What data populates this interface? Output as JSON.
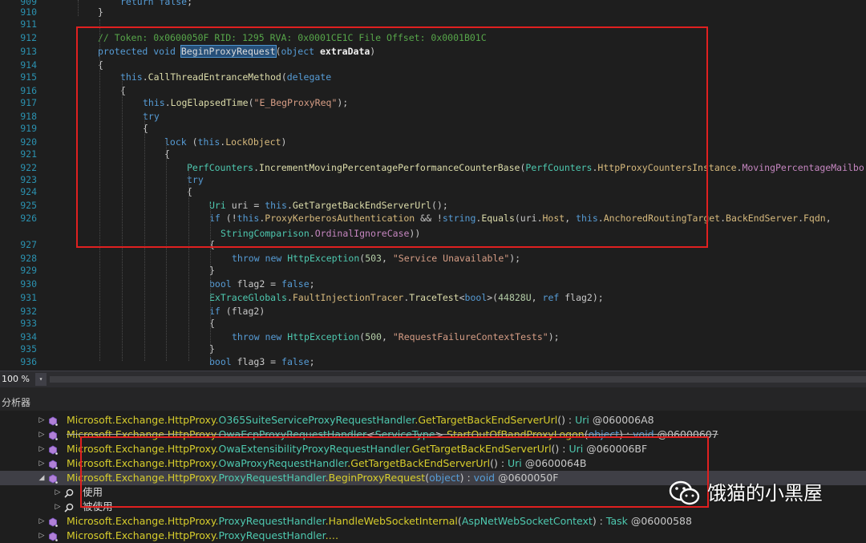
{
  "editor": {
    "lines": [
      {
        "no": "909",
        "segs": [
          [
            "kw",
            "return "
          ],
          [
            "kw",
            "false"
          ],
          [
            "p",
            ";"
          ]
        ]
      },
      {
        "no": "910",
        "segs": [
          [
            "p",
            "}"
          ]
        ]
      },
      {
        "no": "911",
        "segs": []
      },
      {
        "no": "912",
        "segs": [
          [
            "cm",
            "// Token: 0x0600050F RID: 1295 RVA: 0x0001CE1C File Offset: 0x0001B01C"
          ]
        ]
      },
      {
        "no": "913",
        "segs": [
          [
            "kw",
            "protected "
          ],
          [
            "kw",
            "void "
          ],
          [
            "hl",
            "BeginProxyRequest"
          ],
          [
            "p",
            "("
          ],
          [
            "kw",
            "object "
          ],
          [
            "b",
            "extraData"
          ],
          [
            "p",
            ")"
          ]
        ]
      },
      {
        "no": "914",
        "segs": [
          [
            "p",
            "{"
          ]
        ]
      },
      {
        "no": "915",
        "segs": [
          [
            "kw",
            "this"
          ],
          [
            "p",
            "."
          ],
          [
            "m",
            "CallThreadEntranceMethod"
          ],
          [
            "p",
            "("
          ],
          [
            "kw",
            "delegate"
          ]
        ]
      },
      {
        "no": "916",
        "segs": [
          [
            "p",
            "{"
          ]
        ]
      },
      {
        "no": "917",
        "segs": [
          [
            "kw",
            "this"
          ],
          [
            "p",
            "."
          ],
          [
            "m",
            "LogElapsedTime"
          ],
          [
            "p",
            "("
          ],
          [
            "s",
            "\"E_BegProxyReq\""
          ],
          [
            "p",
            ");"
          ]
        ]
      },
      {
        "no": "918",
        "segs": [
          [
            "kw",
            "try"
          ]
        ]
      },
      {
        "no": "919",
        "segs": [
          [
            "p",
            "{"
          ]
        ]
      },
      {
        "no": "920",
        "segs": [
          [
            "kw",
            "lock "
          ],
          [
            "p",
            "("
          ],
          [
            "kw",
            "this"
          ],
          [
            "p",
            "."
          ],
          [
            "pr",
            "LockObject"
          ],
          [
            "p",
            ")"
          ]
        ]
      },
      {
        "no": "921",
        "segs": [
          [
            "p",
            "{"
          ]
        ]
      },
      {
        "no": "922",
        "segs": [
          [
            "ty",
            "PerfCounters"
          ],
          [
            "p",
            "."
          ],
          [
            "m",
            "IncrementMovingPercentagePerformanceCounterBase"
          ],
          [
            "p",
            "("
          ],
          [
            "ty",
            "PerfCounters"
          ],
          [
            "p",
            "."
          ],
          [
            "pr",
            "HttpProxyCountersInstance"
          ],
          [
            "p",
            "."
          ],
          [
            "pu",
            "MovingPercentageMailbo"
          ]
        ]
      },
      {
        "no": "923",
        "segs": [
          [
            "kw",
            "try"
          ]
        ]
      },
      {
        "no": "924",
        "segs": [
          [
            "p",
            "{"
          ]
        ]
      },
      {
        "no": "925",
        "segs": [
          [
            "ty",
            "Uri "
          ],
          [
            "p",
            "uri = "
          ],
          [
            "kw",
            "this"
          ],
          [
            "p",
            "."
          ],
          [
            "m",
            "GetTargetBackEndServerUrl"
          ],
          [
            "p",
            "();"
          ]
        ]
      },
      {
        "no": "926",
        "segs": [
          [
            "kw",
            "if "
          ],
          [
            "p",
            "(!"
          ],
          [
            "kw",
            "this"
          ],
          [
            "p",
            "."
          ],
          [
            "pr",
            "ProxyKerberosAuthentication"
          ],
          [
            "p",
            " && !"
          ],
          [
            "kw",
            "string"
          ],
          [
            "p",
            "."
          ],
          [
            "m",
            "Equals"
          ],
          [
            "p",
            "(uri."
          ],
          [
            "pr",
            "Host"
          ],
          [
            "p",
            ", "
          ],
          [
            "kw",
            "this"
          ],
          [
            "p",
            "."
          ],
          [
            "pr",
            "AnchoredRoutingTarget"
          ],
          [
            "p",
            "."
          ],
          [
            "pr",
            "BackEndServer"
          ],
          [
            "p",
            "."
          ],
          [
            "pr",
            "Fqdn"
          ],
          [
            "p",
            ","
          ]
        ]
      },
      {
        "no": "",
        "segs": [
          [
            "ty",
            "StringComparison"
          ],
          [
            "p",
            "."
          ],
          [
            "pu",
            "OrdinalIgnoreCase"
          ],
          [
            "p",
            "))"
          ]
        ]
      },
      {
        "no": "927",
        "segs": [
          [
            "p",
            "{"
          ]
        ]
      },
      {
        "no": "928",
        "segs": [
          [
            "kw",
            "throw "
          ],
          [
            "kw",
            "new "
          ],
          [
            "ty",
            "HttpException"
          ],
          [
            "p",
            "("
          ],
          [
            "n",
            "503"
          ],
          [
            "p",
            ", "
          ],
          [
            "s",
            "\"Service Unavailable\""
          ],
          [
            "p",
            ");"
          ]
        ]
      },
      {
        "no": "929",
        "segs": [
          [
            "p",
            "}"
          ]
        ]
      },
      {
        "no": "930",
        "segs": [
          [
            "kw",
            "bool "
          ],
          [
            "p",
            "flag2 = "
          ],
          [
            "kw",
            "false"
          ],
          [
            "p",
            ";"
          ]
        ]
      },
      {
        "no": "931",
        "segs": [
          [
            "ty",
            "ExTraceGlobals"
          ],
          [
            "p",
            "."
          ],
          [
            "pr",
            "FaultInjectionTracer"
          ],
          [
            "p",
            "."
          ],
          [
            "m",
            "TraceTest"
          ],
          [
            "p",
            "<"
          ],
          [
            "kw",
            "bool"
          ],
          [
            "p",
            ">("
          ],
          [
            "n",
            "44828U"
          ],
          [
            "p",
            ", "
          ],
          [
            "kw",
            "ref "
          ],
          [
            "p",
            "flag2);"
          ]
        ]
      },
      {
        "no": "932",
        "segs": [
          [
            "kw",
            "if "
          ],
          [
            "p",
            "(flag2)"
          ]
        ]
      },
      {
        "no": "933",
        "segs": [
          [
            "p",
            "{"
          ]
        ]
      },
      {
        "no": "934",
        "segs": [
          [
            "kw",
            "throw "
          ],
          [
            "kw",
            "new "
          ],
          [
            "ty",
            "HttpException"
          ],
          [
            "p",
            "("
          ],
          [
            "n",
            "500"
          ],
          [
            "p",
            ", "
          ],
          [
            "s",
            "\"RequestFailureContextTests\""
          ],
          [
            "p",
            ");"
          ]
        ]
      },
      {
        "no": "935",
        "segs": [
          [
            "p",
            "}"
          ]
        ]
      },
      {
        "no": "936",
        "segs": [
          [
            "kw",
            "bool "
          ],
          [
            "p",
            "flag3 = "
          ],
          [
            "kw",
            "false"
          ],
          [
            "p",
            ";"
          ]
        ]
      }
    ]
  },
  "statusbar": {
    "zoom": "100 %",
    "dropdown_glyph": "▾"
  },
  "panel": {
    "title": "分析器",
    "rows": [
      {
        "segs": [
          [
            "y",
            "Microsoft.Exchange.HttpProxy."
          ],
          [
            "c",
            "O365SuiteServiceProxyRequestHandler"
          ],
          [
            "y",
            "."
          ],
          [
            "y",
            "GetTargetBackEndServerUrl"
          ],
          [
            "p",
            "() : "
          ],
          [
            "c",
            "Uri"
          ],
          [
            "p",
            " @060006A8"
          ]
        ]
      },
      {
        "segs": [
          [
            "y",
            "Microsoft.Exchange.HttpProxy."
          ],
          [
            "c",
            "OwaEcpProxyRequestHandler"
          ],
          [
            "p",
            "<"
          ],
          [
            "c",
            "ServiceType"
          ],
          [
            "p",
            ">."
          ],
          [
            "y",
            "StartOutOfBandProxyLogon"
          ],
          [
            "p",
            "("
          ],
          [
            "bl",
            "object"
          ],
          [
            "p",
            ") : "
          ],
          [
            "bl",
            "void"
          ],
          [
            "p",
            " @06000607"
          ]
        ]
      },
      {
        "segs": [
          [
            "y",
            "Microsoft.Exchange.HttpProxy."
          ],
          [
            "c",
            "OwaExtensibilityProxyRequestHandler"
          ],
          [
            "y",
            "."
          ],
          [
            "y",
            "GetTargetBackEndServerUrl"
          ],
          [
            "p",
            "() : "
          ],
          [
            "c",
            "Uri"
          ],
          [
            "p",
            " @060006BF"
          ]
        ]
      },
      {
        "segs": [
          [
            "y",
            "Microsoft.Exchange.HttpProxy."
          ],
          [
            "c",
            "OwaProxyRequestHandler"
          ],
          [
            "y",
            "."
          ],
          [
            "y",
            "GetTargetBackEndServerUrl"
          ],
          [
            "p",
            "() : "
          ],
          [
            "c",
            "Uri"
          ],
          [
            "p",
            " @0600064B"
          ]
        ]
      },
      {
        "segs": [
          [
            "y",
            "Microsoft.Exchange.HttpProxy."
          ],
          [
            "c",
            "ProxyRequestHandler"
          ],
          [
            "y",
            "."
          ],
          [
            "y",
            "BeginProxyRequest"
          ],
          [
            "p",
            "("
          ],
          [
            "bl",
            "object"
          ],
          [
            "p",
            ") : "
          ],
          [
            "bl",
            "void"
          ],
          [
            "p",
            " @0600050F"
          ]
        ]
      },
      {
        "segs": [
          [
            "w",
            "使用"
          ]
        ]
      },
      {
        "segs": [
          [
            "w",
            "被使用"
          ]
        ]
      },
      {
        "segs": [
          [
            "y",
            "Microsoft.Exchange.HttpProxy."
          ],
          [
            "c",
            "ProxyRequestHandler"
          ],
          [
            "y",
            "."
          ],
          [
            "y",
            "HandleWebSocketInternal"
          ],
          [
            "p",
            "("
          ],
          [
            "c",
            "AspNetWebSocketContext"
          ],
          [
            "p",
            ") : "
          ],
          [
            "c",
            "Task"
          ],
          [
            "p",
            " @06000588"
          ]
        ]
      },
      {
        "segs": [
          [
            "y",
            "Microsoft.Exchange.HttpProxy."
          ],
          [
            "c",
            "ProxyRequestHandler"
          ],
          [
            "y",
            "."
          ],
          [
            "y",
            "…"
          ]
        ]
      }
    ]
  },
  "watermark": {
    "text": "饿猫的小黑屋"
  }
}
